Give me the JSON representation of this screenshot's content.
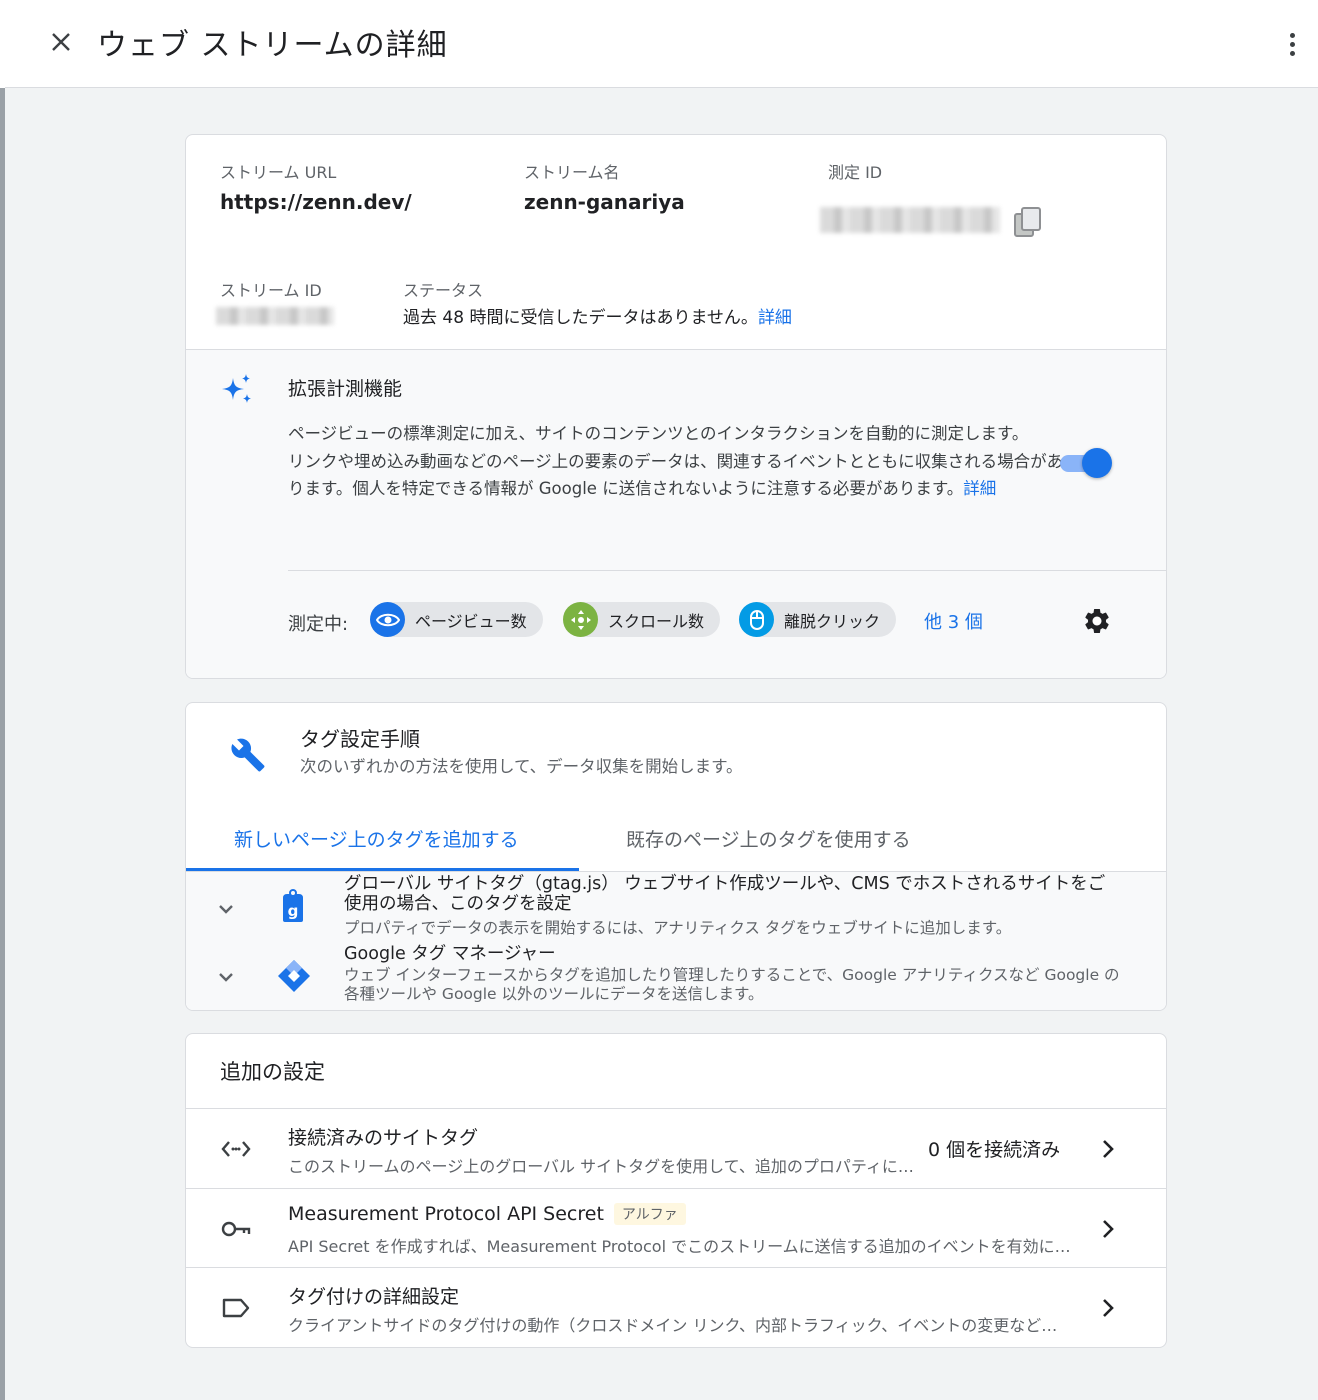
{
  "header": {
    "title": "ウェブ ストリームの詳細",
    "close_icon": "close-icon",
    "more_icon": "more-vert-icon"
  },
  "stream": {
    "url_label": "ストリーム URL",
    "url": "https://zenn.dev/",
    "name_label": "ストリーム名",
    "name": "zenn-ganariya",
    "measurement_id_label": "測定 ID",
    "stream_id_label": "ストリーム ID",
    "status_label": "ステータス",
    "status_text": "過去 48 時間に受信したデータはありません。",
    "status_link": "詳細"
  },
  "enhanced": {
    "title": "拡張計測機能",
    "desc_line1": "ページビューの標準測定に加え、サイトのコンテンツとのインタラクションを自動的に測定します。",
    "desc_line2": "リンクや埋め込み動画などのページ上の要素のデータは、関連するイベントとともに収集される場合があります。個人を特定できる情報が Google に送信されないように注意する必要があります。",
    "desc_link": "詳細",
    "toggle_on": true,
    "measuring_label": "測定中:",
    "chips": [
      {
        "label": "ページビュー数",
        "icon": "eye-icon",
        "color": "#1a73e8"
      },
      {
        "label": "スクロール数",
        "icon": "scroll-icon",
        "color": "#7cb342"
      },
      {
        "label": "離脱クリック",
        "icon": "mouse-icon",
        "color": "#039be5"
      }
    ],
    "others": "他 3 個"
  },
  "tagging": {
    "title": "タグ設定手順",
    "subtitle": "次のいずれかの方法を使用して、データ収集を開始します。",
    "tab_new": "新しいページ上のタグを追加する",
    "tab_existing": "既存のページ上のタグを使用する",
    "methods": [
      {
        "title": "グローバル サイトタグ（gtag.js） ウェブサイト作成ツールや、CMS でホストされるサイトをご使用の場合、このタグを設定",
        "desc": "プロパティでデータの表示を開始するには、アナリティクス タグをウェブサイトに追加します。"
      },
      {
        "title": "Google タグ マネージャー",
        "desc": "ウェブ インターフェースからタグを追加したり管理したりすることで、Google アナリティクスなど Google の各種ツールや Google 以外のツールにデータを送信します。"
      }
    ]
  },
  "additional": {
    "title": "追加の設定",
    "rows": [
      {
        "title": "接続済みのサイトタグ",
        "desc": "このストリームのページ上のグローバル サイトタグを使用して、追加のプロパティにデータを送信します。",
        "count": "0 個を接続済み",
        "icon": "code-icon"
      },
      {
        "title": "Measurement Protocol API Secret",
        "badge": "アルファ",
        "desc": "API Secret を作成すれば、Measurement Protocol でこのストリームに送信する追加のイベントを有効にできます。",
        "icon": "key-icon"
      },
      {
        "title": "タグ付けの詳細設定",
        "desc": "クライアントサイドのタグ付けの動作（クロスドメイン リンク、内部トラフィック、イベントの変更など）を設定します。",
        "icon": "label-icon"
      }
    ]
  }
}
